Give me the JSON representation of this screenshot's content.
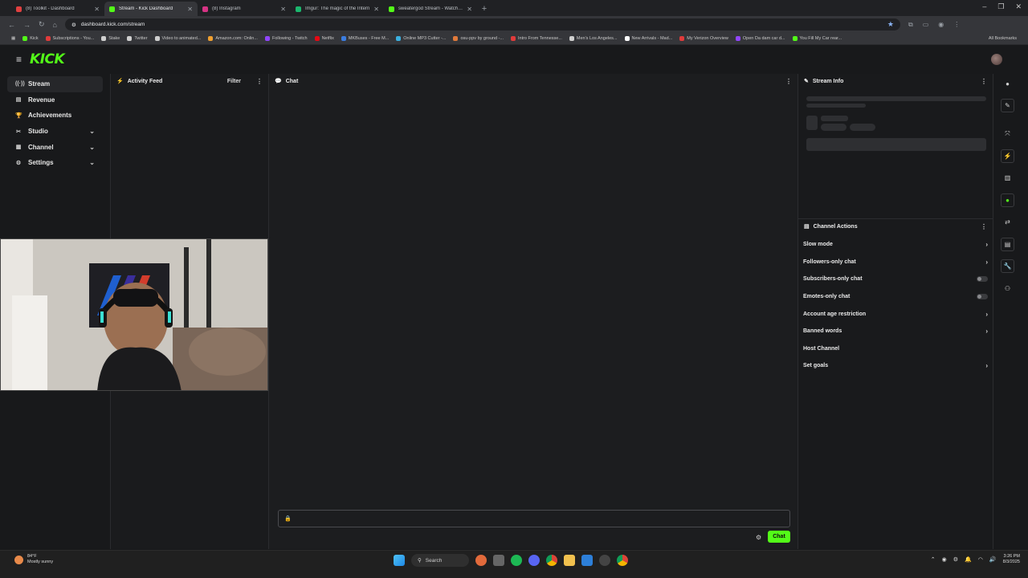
{
  "browser": {
    "tabs": [
      {
        "title": "(8) Toolkit - Dashboard",
        "color": "#e04040",
        "active": false
      },
      {
        "title": "Stream - Kick Dashboard",
        "color": "#53fc18",
        "active": true
      },
      {
        "title": "(8) Instagram",
        "color": "#d63384",
        "active": false
      },
      {
        "title": "Imgur: The magic of the Intern",
        "color": "#1bb76e",
        "active": false
      },
      {
        "title": "sweatergod Stream - Watch Li",
        "color": "#53fc18",
        "active": false
      }
    ],
    "new_tab_label": "+",
    "url": "dashboard.kick.com/stream",
    "bookmarks": [
      {
        "label": "Kick",
        "color": "#53fc18"
      },
      {
        "label": "Subscriptions - You...",
        "color": "#e03b3b"
      },
      {
        "label": "Stake",
        "color": "#cfcfcf"
      },
      {
        "label": "Twitter",
        "color": "#cfcfcf"
      },
      {
        "label": "Video to animated...",
        "color": "#cfcfcf"
      },
      {
        "label": "Amazon.com: Onlin...",
        "color": "#f0a030"
      },
      {
        "label": "Following - Twitch",
        "color": "#9146ff"
      },
      {
        "label": "Netflix",
        "color": "#e50914"
      },
      {
        "label": "MKBuses - Free M...",
        "color": "#3b7de0"
      },
      {
        "label": "Online MP3 Cutter -...",
        "color": "#3bb0e0"
      },
      {
        "label": "osu-ppv by ground -...",
        "color": "#e07a3b"
      },
      {
        "label": "Intro From Tennesse...",
        "color": "#e03b3b"
      },
      {
        "label": "Men's Los Angeles...",
        "color": "#cfcfcf"
      },
      {
        "label": "New Arrivals - Mad...",
        "color": "#ffffff"
      },
      {
        "label": "My Verizon Overview",
        "color": "#e03b3b"
      },
      {
        "label": "Open Da dam car d...",
        "color": "#9146ff"
      },
      {
        "label": "You Fill My Car rear...",
        "color": "#53fc18"
      }
    ],
    "all_bookmarks_label": "All Bookmarks"
  },
  "header": {
    "logo_text": "KICK"
  },
  "nav": {
    "items": [
      {
        "label": "Stream",
        "icon": "stream-icon",
        "glyph": "((·))",
        "active": true,
        "expandable": false
      },
      {
        "label": "Revenue",
        "icon": "revenue-icon",
        "glyph": "▤",
        "active": false,
        "expandable": false
      },
      {
        "label": "Achievements",
        "icon": "trophy-icon",
        "glyph": "🏆",
        "active": false,
        "expandable": false
      },
      {
        "label": "Studio",
        "icon": "studio-icon",
        "glyph": "✂",
        "active": false,
        "expandable": true
      },
      {
        "label": "Channel",
        "icon": "channel-icon",
        "glyph": "▦",
        "active": false,
        "expandable": true
      },
      {
        "label": "Settings",
        "icon": "settings-gear-icon",
        "glyph": "⚙",
        "active": false,
        "expandable": true
      }
    ]
  },
  "activity_feed": {
    "title": "Activity Feed",
    "filter_label": "Filter"
  },
  "chat": {
    "title": "Chat",
    "input_placeholder": "",
    "send_label": "Chat"
  },
  "stream_info": {
    "title": "Stream Info"
  },
  "channel_actions": {
    "title": "Channel Actions",
    "items": [
      {
        "label": "Slow mode",
        "control": "arrow"
      },
      {
        "label": "Followers-only chat",
        "control": "arrow"
      },
      {
        "label": "Subscribers-only chat",
        "control": "toggle"
      },
      {
        "label": "Emotes-only chat",
        "control": "toggle"
      },
      {
        "label": "Account age restriction",
        "control": "arrow"
      },
      {
        "label": "Banned words",
        "control": "arrow"
      },
      {
        "label": "Host Channel",
        "control": "none"
      },
      {
        "label": "Set goals",
        "control": "arrow"
      }
    ]
  },
  "taskbar": {
    "weather_temp": "84°F",
    "weather_desc": "Mostly sunny",
    "search_label": "Search",
    "time": "3:26 PM",
    "date": "8/3/2025"
  },
  "colors": {
    "kick_green": "#53fc18"
  }
}
